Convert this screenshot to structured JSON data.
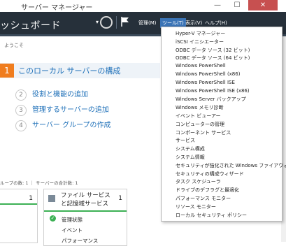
{
  "window": {
    "title": "サーバー マネージャー",
    "minimize": "—",
    "maximize": "☐",
    "close": "✕"
  },
  "header": {
    "title": "ッシュボード",
    "menus": [
      {
        "label": "管理(M)"
      },
      {
        "label": "ツール(T)"
      },
      {
        "label": "表示(V)"
      },
      {
        "label": "ヘルプ(H)"
      }
    ]
  },
  "main": {
    "welcome": "ようこそ",
    "steps": [
      {
        "num": "1",
        "label": "このローカル サーバーの構成"
      },
      {
        "num": "2",
        "label": "役割と機能の追加"
      },
      {
        "num": "3",
        "label": "管理するサーバーの追加"
      },
      {
        "num": "4",
        "label": "サーバー グループの作成"
      }
    ],
    "groups_text": "ループの数: 1 ｜ サーバーの合計数: 1",
    "card_left_count": "1",
    "card": {
      "title": "ファイル サービスと記憶域サービス",
      "count": "1",
      "rows": [
        "管理状態",
        "イベント",
        "パフォーマンス"
      ],
      "ok_icon": "✓"
    }
  },
  "tools_menu": [
    "Hyper-V マネージャー",
    "iSCSI イニシエーター",
    "ODBC データ ソース (32 ビット)",
    "ODBC データ ソース (64 ビット)",
    "Windows PowerShell",
    "Windows PowerShell (x86)",
    "Windows PowerShell ISE",
    "Windows PowerShell ISE (x86)",
    "Windows Server バックアップ",
    "Windows メモリ診断",
    "イベント ビューアー",
    "コンピューターの管理",
    "コンポーネント サービス",
    "サービス",
    "システム構成",
    "システム情報",
    "セキュリティが強化された Windows ファイアウォール",
    "セキュリティの構成ウィザード",
    "タスク スケジューラ",
    "ドライブのデフラグと最適化",
    "パフォーマンス モニター",
    "リソース モニター",
    "ローカル セキュリティ ポリシー"
  ],
  "colors": {
    "header_bg": "#26303a",
    "accent": "#1d6fb8",
    "step_highlight": "#f07d1e",
    "status_ok": "#3cb054",
    "menu_active": "#3b74b6"
  }
}
